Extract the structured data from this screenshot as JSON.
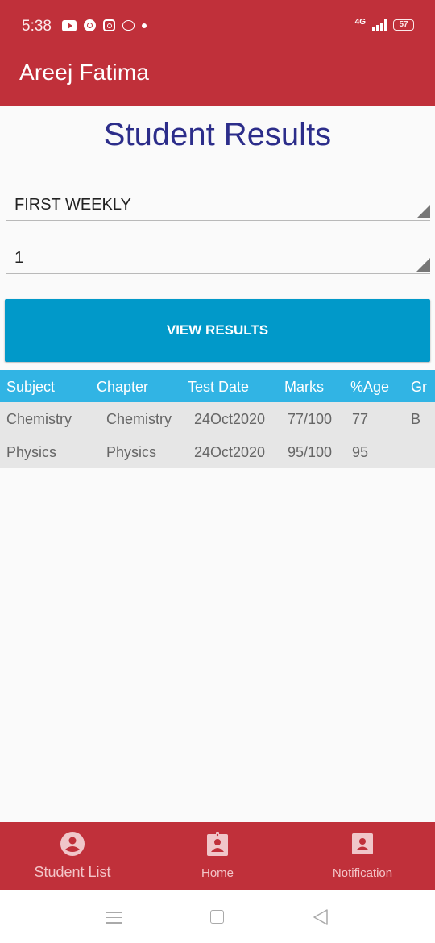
{
  "status_bar": {
    "time": "5:38",
    "left_icons": [
      "youtube-icon",
      "chrome-icon",
      "instagram-icon",
      "panda-icon",
      "dot-icon"
    ],
    "network": "4G",
    "battery": "57"
  },
  "app_bar": {
    "title": "Areej Fatima"
  },
  "page": {
    "title": "Student Results"
  },
  "filters": {
    "exam_type": "FIRST WEEKLY",
    "number": "1"
  },
  "actions": {
    "view_results_label": "VIEW RESULTS"
  },
  "results_table": {
    "columns": [
      "Subject",
      "Chapter",
      "Test Date",
      "Marks",
      "%Age",
      "Gr"
    ],
    "rows": [
      [
        "Chemistry",
        "Chemistry",
        "24Oct2020",
        "77/100",
        "77",
        "B"
      ],
      [
        "Physics",
        "Physics",
        "24Oct2020",
        "95/100",
        "95",
        ""
      ]
    ]
  },
  "bottom_nav": {
    "items": [
      {
        "label": "Student List",
        "icon": "account-circle-icon"
      },
      {
        "label": "Home",
        "icon": "badge-icon"
      },
      {
        "label": "Notification",
        "icon": "contact-box-icon"
      }
    ]
  },
  "colors": {
    "primary": "#c0303a",
    "title": "#2c2d8a",
    "button": "#0199c9",
    "table_header": "#31b4e4",
    "table_row": "#e6e6e6"
  }
}
